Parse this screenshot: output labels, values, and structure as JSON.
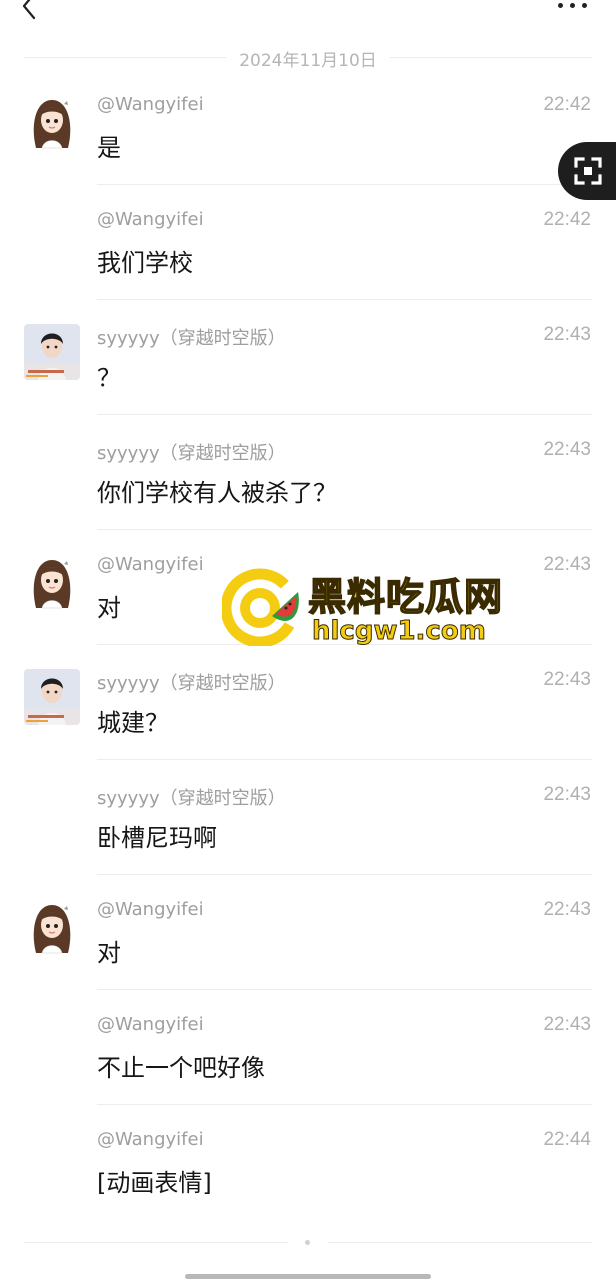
{
  "header": {
    "back_icon": "chevron-left-icon",
    "more_icon": "more-horizontal-icon"
  },
  "date_divider": "2024年11月10日",
  "messages": [
    {
      "sender": "@Wangyifei",
      "time": "22:42",
      "text": "是",
      "avatar": "wangyifei"
    },
    {
      "sender": "@Wangyifei",
      "time": "22:42",
      "text": "我们学校",
      "avatar": null
    },
    {
      "sender": "syyyyy（穿越时空版）",
      "time": "22:43",
      "text": "？",
      "avatar": "syyyyy"
    },
    {
      "sender": "syyyyy（穿越时空版）",
      "time": "22:43",
      "text": "你们学校有人被杀了？",
      "avatar": null
    },
    {
      "sender": "@Wangyifei",
      "time": "22:43",
      "text": "对",
      "avatar": "wangyifei"
    },
    {
      "sender": "syyyyy（穿越时空版）",
      "time": "22:43",
      "text": "城建？",
      "avatar": "syyyyy"
    },
    {
      "sender": "syyyyy（穿越时空版）",
      "time": "22:43",
      "text": "卧槽尼玛啊",
      "avatar": null
    },
    {
      "sender": "@Wangyifei",
      "time": "22:43",
      "text": "对",
      "avatar": "wangyifei"
    },
    {
      "sender": "@Wangyifei",
      "time": "22:43",
      "text": "不止一个吧好像",
      "avatar": null
    },
    {
      "sender": "@Wangyifei",
      "time": "22:44",
      "text": "[动画表情]",
      "avatar": null
    }
  ],
  "floating_tool_icon": "expand-icon",
  "watermark": {
    "title": "黑料吃瓜网",
    "url": "hlcgw1.com"
  },
  "colors": {
    "background": "#ffffff",
    "meta_text": "#9e9e9e",
    "message_text": "#161616",
    "watermark_yellow": "#f4cd12"
  }
}
